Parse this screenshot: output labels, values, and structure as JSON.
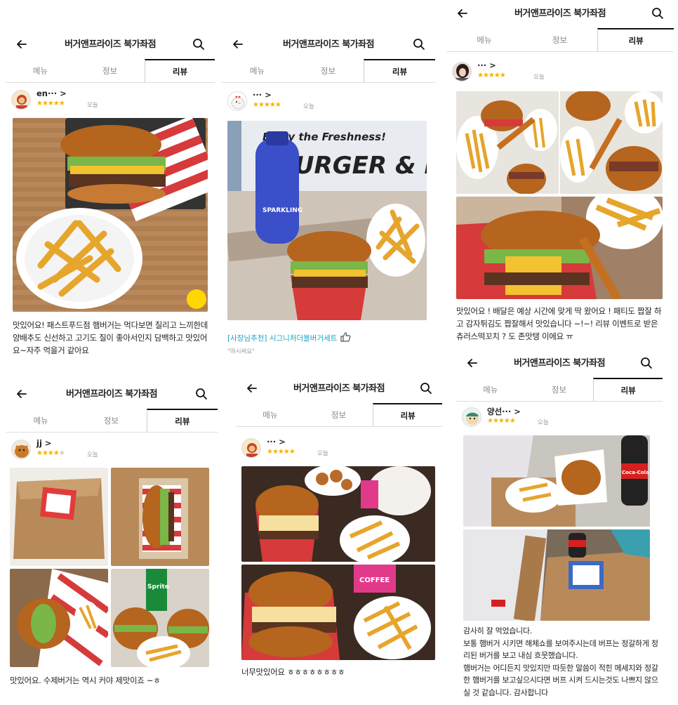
{
  "header": {
    "title": "버거앤프라이즈 북가좌점"
  },
  "tabs": [
    "메뉴",
    "정보",
    "리뷰"
  ],
  "reviews": [
    {
      "user": "en··· >",
      "stars": "★★★★★",
      "date": "오늘",
      "text": "맛있어요! 패스트푸드점 햄버거는 먹다보면 질리고 느끼한데 양배추도 신선하고 고기도 질이 좋아서인지 담백하고 맛있어요~자주 먹을거 같아요"
    },
    {
      "user": "··· >",
      "stars": "★★★★★",
      "date": "오늘",
      "menu_prefix": "[사장님추천]",
      "menu_name": "시그니처더블버거세트",
      "sub": "\"마시써요\"",
      "banner_line1": "Enjoy the Freshness!",
      "banner_line2": "BURGER & FRI",
      "bottle_label": "SPARKLING"
    },
    {
      "user": "··· >",
      "stars": "★★★★★",
      "date": "오늘",
      "text": "맛있어요 ! 배달은 예상 시간에 맞게 딱 왔어요 ! 패티도 짭잘 하고 감자튀김도 짭잘해서 맛있습니다 ~!~! 리뷰 이벤트로 받은 츄러스떡꼬치 ? 도 존맛탱 이에요 ㅠ"
    },
    {
      "user": "jj >",
      "stars_on": "★★★★",
      "stars_off": "★",
      "date": "오늘",
      "text": "맛있어요. 수제버거는 역시 커야 제맛이죠 ~ㅎ",
      "can_label": "Sprite"
    },
    {
      "user": "··· >",
      "stars": "★★★★★",
      "date": "오늘",
      "text": "너무맛있어요 ㅎㅎㅎㅎㅎㅎㅎㅎ",
      "cup_label": "COFFEE"
    },
    {
      "user": "양선··· >",
      "stars": "★★★★★",
      "date": "오늘",
      "text": "감사히 잘 먹었습니다.\n보통 햄버거 시키면 해체쇼를 보여주시는데 버프는 정갈하게 정리된 버거를 보고 내심 흐뭇했습니다.\n햄버거는 어디든지 맛있지만 따듯한 말씀이 적힌 메세지와 정갈한 햄버거를 보고싶으시다면 버프 시켜 드시는것도 나쁘지 않으실 것 같습니다. 감사합니다",
      "cola_label": "Coca-Cola"
    }
  ],
  "colors": {
    "star": "#f5b301",
    "link": "#1aa3c4",
    "tab_active": "#111111"
  }
}
